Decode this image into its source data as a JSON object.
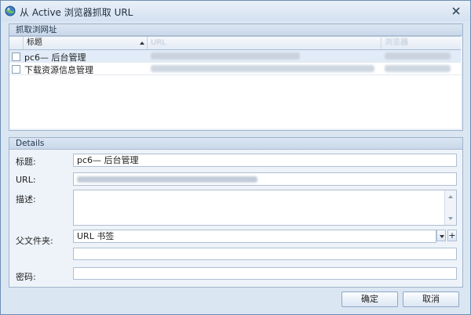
{
  "window": {
    "title": "从 Active 浏览器抓取 URL",
    "icon": "globe-icon",
    "close_icon": "close-icon"
  },
  "capture_group": {
    "header": "抓取浏网址",
    "columns": [
      "标题",
      "URL",
      "浏览器"
    ],
    "rows": [
      {
        "title": "pc6— 后台管理",
        "url": "http://pc6.com/jiadfhdbafnk_index.asp",
        "browser": "Internet Explorer",
        "selected": true,
        "checked": false
      },
      {
        "title": "下载资源信息管理",
        "url": "http://pc6.com/jiadfhdbafnk_down_resource.asp?action...",
        "browser": "Internet Explorer",
        "selected": false,
        "checked": false
      }
    ]
  },
  "details": {
    "header": "Details",
    "title_label": "标题:",
    "title_value": "pc6— 后台管理",
    "url_label": "URL:",
    "url_value": "http://pc6.com/jiadfhdbafnk_index.asp",
    "desc_label": "描述:",
    "desc_value": "",
    "parent_label": "父文件夹:",
    "parent_value": "URL 书签",
    "parent_extra_value": "",
    "password_label": "密码:",
    "password_value": ""
  },
  "buttons": {
    "ok": "确定",
    "cancel": "取消"
  },
  "colors": {
    "window_bg": "#dbe6f3",
    "border": "#6f8db3",
    "selected_row": "#e2ecf8"
  }
}
